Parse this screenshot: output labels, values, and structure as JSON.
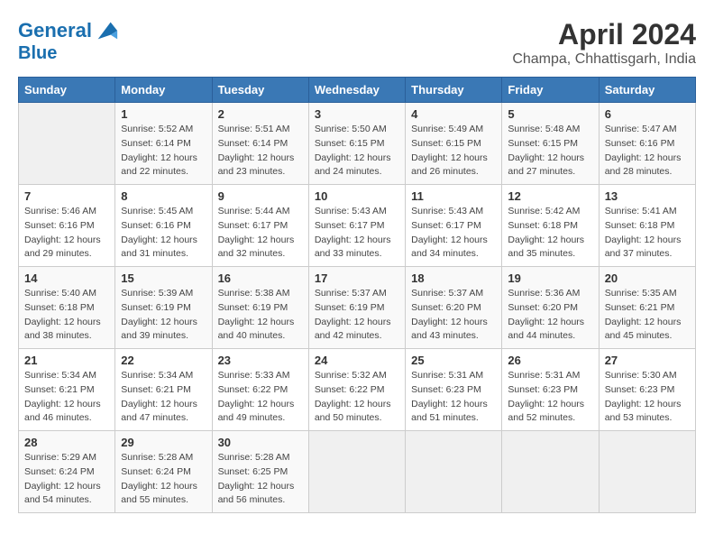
{
  "header": {
    "logo_line1": "General",
    "logo_line2": "Blue",
    "month_title": "April 2024",
    "subtitle": "Champa, Chhattisgarh, India"
  },
  "weekdays": [
    "Sunday",
    "Monday",
    "Tuesday",
    "Wednesday",
    "Thursday",
    "Friday",
    "Saturday"
  ],
  "weeks": [
    [
      {
        "day": "",
        "info": ""
      },
      {
        "day": "1",
        "info": "Sunrise: 5:52 AM\nSunset: 6:14 PM\nDaylight: 12 hours\nand 22 minutes."
      },
      {
        "day": "2",
        "info": "Sunrise: 5:51 AM\nSunset: 6:14 PM\nDaylight: 12 hours\nand 23 minutes."
      },
      {
        "day": "3",
        "info": "Sunrise: 5:50 AM\nSunset: 6:15 PM\nDaylight: 12 hours\nand 24 minutes."
      },
      {
        "day": "4",
        "info": "Sunrise: 5:49 AM\nSunset: 6:15 PM\nDaylight: 12 hours\nand 26 minutes."
      },
      {
        "day": "5",
        "info": "Sunrise: 5:48 AM\nSunset: 6:15 PM\nDaylight: 12 hours\nand 27 minutes."
      },
      {
        "day": "6",
        "info": "Sunrise: 5:47 AM\nSunset: 6:16 PM\nDaylight: 12 hours\nand 28 minutes."
      }
    ],
    [
      {
        "day": "7",
        "info": "Sunrise: 5:46 AM\nSunset: 6:16 PM\nDaylight: 12 hours\nand 29 minutes."
      },
      {
        "day": "8",
        "info": "Sunrise: 5:45 AM\nSunset: 6:16 PM\nDaylight: 12 hours\nand 31 minutes."
      },
      {
        "day": "9",
        "info": "Sunrise: 5:44 AM\nSunset: 6:17 PM\nDaylight: 12 hours\nand 32 minutes."
      },
      {
        "day": "10",
        "info": "Sunrise: 5:43 AM\nSunset: 6:17 PM\nDaylight: 12 hours\nand 33 minutes."
      },
      {
        "day": "11",
        "info": "Sunrise: 5:43 AM\nSunset: 6:17 PM\nDaylight: 12 hours\nand 34 minutes."
      },
      {
        "day": "12",
        "info": "Sunrise: 5:42 AM\nSunset: 6:18 PM\nDaylight: 12 hours\nand 35 minutes."
      },
      {
        "day": "13",
        "info": "Sunrise: 5:41 AM\nSunset: 6:18 PM\nDaylight: 12 hours\nand 37 minutes."
      }
    ],
    [
      {
        "day": "14",
        "info": "Sunrise: 5:40 AM\nSunset: 6:18 PM\nDaylight: 12 hours\nand 38 minutes."
      },
      {
        "day": "15",
        "info": "Sunrise: 5:39 AM\nSunset: 6:19 PM\nDaylight: 12 hours\nand 39 minutes."
      },
      {
        "day": "16",
        "info": "Sunrise: 5:38 AM\nSunset: 6:19 PM\nDaylight: 12 hours\nand 40 minutes."
      },
      {
        "day": "17",
        "info": "Sunrise: 5:37 AM\nSunset: 6:19 PM\nDaylight: 12 hours\nand 42 minutes."
      },
      {
        "day": "18",
        "info": "Sunrise: 5:37 AM\nSunset: 6:20 PM\nDaylight: 12 hours\nand 43 minutes."
      },
      {
        "day": "19",
        "info": "Sunrise: 5:36 AM\nSunset: 6:20 PM\nDaylight: 12 hours\nand 44 minutes."
      },
      {
        "day": "20",
        "info": "Sunrise: 5:35 AM\nSunset: 6:21 PM\nDaylight: 12 hours\nand 45 minutes."
      }
    ],
    [
      {
        "day": "21",
        "info": "Sunrise: 5:34 AM\nSunset: 6:21 PM\nDaylight: 12 hours\nand 46 minutes."
      },
      {
        "day": "22",
        "info": "Sunrise: 5:34 AM\nSunset: 6:21 PM\nDaylight: 12 hours\nand 47 minutes."
      },
      {
        "day": "23",
        "info": "Sunrise: 5:33 AM\nSunset: 6:22 PM\nDaylight: 12 hours\nand 49 minutes."
      },
      {
        "day": "24",
        "info": "Sunrise: 5:32 AM\nSunset: 6:22 PM\nDaylight: 12 hours\nand 50 minutes."
      },
      {
        "day": "25",
        "info": "Sunrise: 5:31 AM\nSunset: 6:23 PM\nDaylight: 12 hours\nand 51 minutes."
      },
      {
        "day": "26",
        "info": "Sunrise: 5:31 AM\nSunset: 6:23 PM\nDaylight: 12 hours\nand 52 minutes."
      },
      {
        "day": "27",
        "info": "Sunrise: 5:30 AM\nSunset: 6:23 PM\nDaylight: 12 hours\nand 53 minutes."
      }
    ],
    [
      {
        "day": "28",
        "info": "Sunrise: 5:29 AM\nSunset: 6:24 PM\nDaylight: 12 hours\nand 54 minutes."
      },
      {
        "day": "29",
        "info": "Sunrise: 5:28 AM\nSunset: 6:24 PM\nDaylight: 12 hours\nand 55 minutes."
      },
      {
        "day": "30",
        "info": "Sunrise: 5:28 AM\nSunset: 6:25 PM\nDaylight: 12 hours\nand 56 minutes."
      },
      {
        "day": "",
        "info": ""
      },
      {
        "day": "",
        "info": ""
      },
      {
        "day": "",
        "info": ""
      },
      {
        "day": "",
        "info": ""
      }
    ]
  ]
}
